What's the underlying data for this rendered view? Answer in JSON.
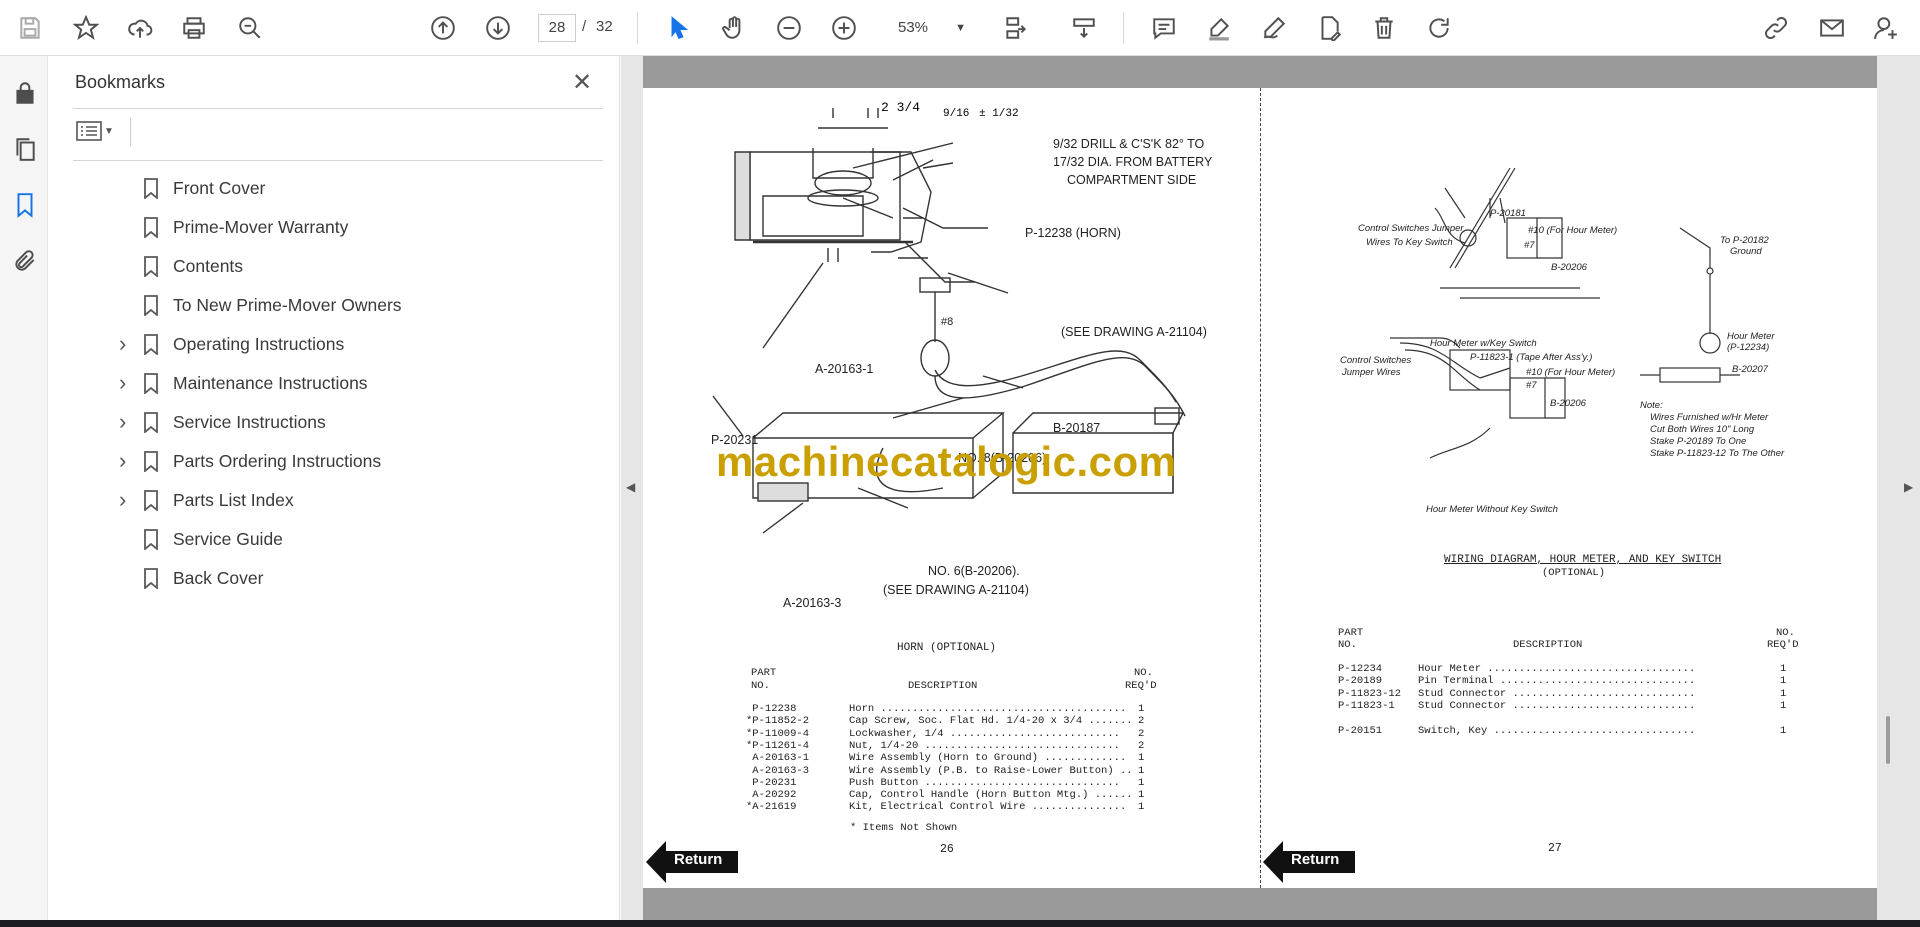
{
  "toolbar": {
    "page_current": "28",
    "page_sep": "/",
    "page_total": "32",
    "zoom": "53%"
  },
  "bookmarks_panel": {
    "title": "Bookmarks",
    "items": [
      {
        "label": "Front Cover",
        "expandable": false
      },
      {
        "label": "Prime-Mover Warranty",
        "expandable": false
      },
      {
        "label": "Contents",
        "expandable": false
      },
      {
        "label": "To New Prime-Mover Owners",
        "expandable": false
      },
      {
        "label": "Operating Instructions",
        "expandable": true
      },
      {
        "label": "Maintenance Instructions",
        "expandable": true
      },
      {
        "label": "Service Instructions",
        "expandable": true
      },
      {
        "label": "Parts Ordering Instructions",
        "expandable": true
      },
      {
        "label": "Parts List Index",
        "expandable": true
      },
      {
        "label": "Service Guide",
        "expandable": false
      },
      {
        "label": "Back Cover",
        "expandable": false
      }
    ]
  },
  "document": {
    "watermark": "machinecatalogic.com",
    "return_label": "Return",
    "left_page": {
      "callouts": {
        "d1": "2 3/4",
        "d2": "9/16",
        "d3": "± 1/32",
        "drill1": "9/32 DRILL & C'S'K 82° TO",
        "drill2": "17/32 DIA. FROM BATTERY",
        "drill3": "COMPARTMENT SIDE",
        "horn": "P-12238 (HORN)",
        "see1": "(SEE DRAWING A-21104)",
        "num8": "#8",
        "a1": "A-20163-1",
        "b20187": "B-20187",
        "p20231": "P-20231",
        "no8": "NO. 8(B-20206)",
        "no6": "NO. 6(B-20206).",
        "see2": "(SEE DRAWING A-21104)",
        "a3": "A-20163-3"
      },
      "table_title": "HORN (OPTIONAL)",
      "col_part": "PART",
      "col_no": "NO.",
      "col_desc": "DESCRIPTION",
      "col_reqno": "NO.",
      "col_req": "REQ'D",
      "rows": [
        {
          "part": " P-12238",
          "desc": "Horn .......................................",
          "qty": "1"
        },
        {
          "part": "*P-11852-2",
          "desc": "Cap Screw, Soc. Flat Hd. 1/4-20 x 3/4 .......",
          "qty": "2"
        },
        {
          "part": "*P-11009-4",
          "desc": "Lockwasher, 1/4 ...........................",
          "qty": "2"
        },
        {
          "part": "*P-11261-4",
          "desc": "Nut, 1/4-20 ...............................",
          "qty": "2"
        },
        {
          "part": " A-20163-1",
          "desc": "Wire Assembly (Horn to Ground) .............",
          "qty": "1"
        },
        {
          "part": " A-20163-3",
          "desc": "Wire Assembly (P.B. to Raise-Lower Button) ..",
          "qty": "1"
        },
        {
          "part": " P-20231",
          "desc": "Push Button ...............................",
          "qty": "1"
        },
        {
          "part": " A-20292",
          "desc": "Cap, Control Handle (Horn Button Mtg.) ......",
          "qty": "1"
        },
        {
          "part": "*A-21619",
          "desc": "Kit, Electrical Control Wire ...............",
          "qty": "1"
        }
      ],
      "footnote": "* Items Not Shown",
      "page_number": "26"
    },
    "right_page": {
      "callouts": {
        "ctrl_jumper": "Control Switches Jumper",
        "wires_key": "Wires To Key Switch",
        "p20181": "P-20181",
        "n10a": "#10 (For Hour Meter)",
        "n7a": "#7",
        "b20206a": "B-20206",
        "hm_key": "Hour Meter w/Key Switch",
        "ctrl_sw": "Control Switches",
        "jumper_w": "Jumper Wires",
        "p11823": "P-11823-1 (Tape After Ass'y.)",
        "n10b": "#10 (For Hour Meter)",
        "n7b": "#7",
        "b20206b": "B-20206",
        "hm_nokey": "Hour Meter Without Key Switch",
        "to_p20182": "To P-20182",
        "ground": "Ground",
        "hour_meter": "Hour Meter",
        "p12234": "(P-12234)",
        "b20207": "B-20207",
        "note": "Note:",
        "note1": "Wires Furnished w/Hr Meter",
        "note2": "Cut Both Wires 10\" Long",
        "note3": "Stake P-20189 To One",
        "note4": "Stake P-11823-12 To The Other"
      },
      "diagram_title": "WIRING DIAGRAM, HOUR METER, AND KEY SWITCH",
      "diagram_sub": "(OPTIONAL)",
      "col_part": "PART",
      "col_no": "NO.",
      "col_desc": "DESCRIPTION",
      "col_reqno": "NO.",
      "col_req": "REQ'D",
      "rows": [
        {
          "part": "P-12234",
          "desc": "Hour Meter .................................",
          "qty": "1"
        },
        {
          "part": "P-20189",
          "desc": "Pin Terminal ...............................",
          "qty": "1"
        },
        {
          "part": "P-11823-12",
          "desc": "Stud Connector .............................",
          "qty": "1"
        },
        {
          "part": "P-11823-1",
          "desc": "Stud Connector .............................",
          "qty": "1"
        },
        {
          "part": "P-20151",
          "desc": "Switch, Key ................................",
          "qty": "1"
        }
      ],
      "page_number": "27"
    }
  }
}
